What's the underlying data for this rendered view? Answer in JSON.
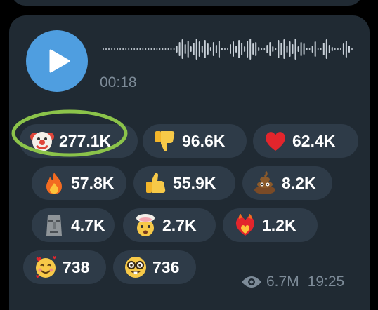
{
  "voice_message": {
    "duration": "00:18",
    "play_icon": "play-icon",
    "accent_color": "#4f9ee0"
  },
  "reactions": [
    {
      "emoji": "clown-face",
      "count": "277.1K"
    },
    {
      "emoji": "thumbs-down",
      "count": "96.6K"
    },
    {
      "emoji": "red-heart",
      "count": "62.4K"
    },
    {
      "emoji": "fire",
      "count": "57.8K"
    },
    {
      "emoji": "thumbs-up",
      "count": "55.9K"
    },
    {
      "emoji": "pile-of-poo",
      "count": "8.2K"
    },
    {
      "emoji": "moai",
      "count": "4.7K"
    },
    {
      "emoji": "exploding-head",
      "count": "2.7K"
    },
    {
      "emoji": "heart-on-fire",
      "count": "1.2K"
    },
    {
      "emoji": "smiling-face-with-hearts",
      "count": "738"
    },
    {
      "emoji": "nerd-face",
      "count": "736"
    }
  ],
  "highlight": {
    "color": "#8bc34a"
  },
  "footer": {
    "views_icon": "eye-icon",
    "views": "6.7M",
    "time": "19:25"
  }
}
